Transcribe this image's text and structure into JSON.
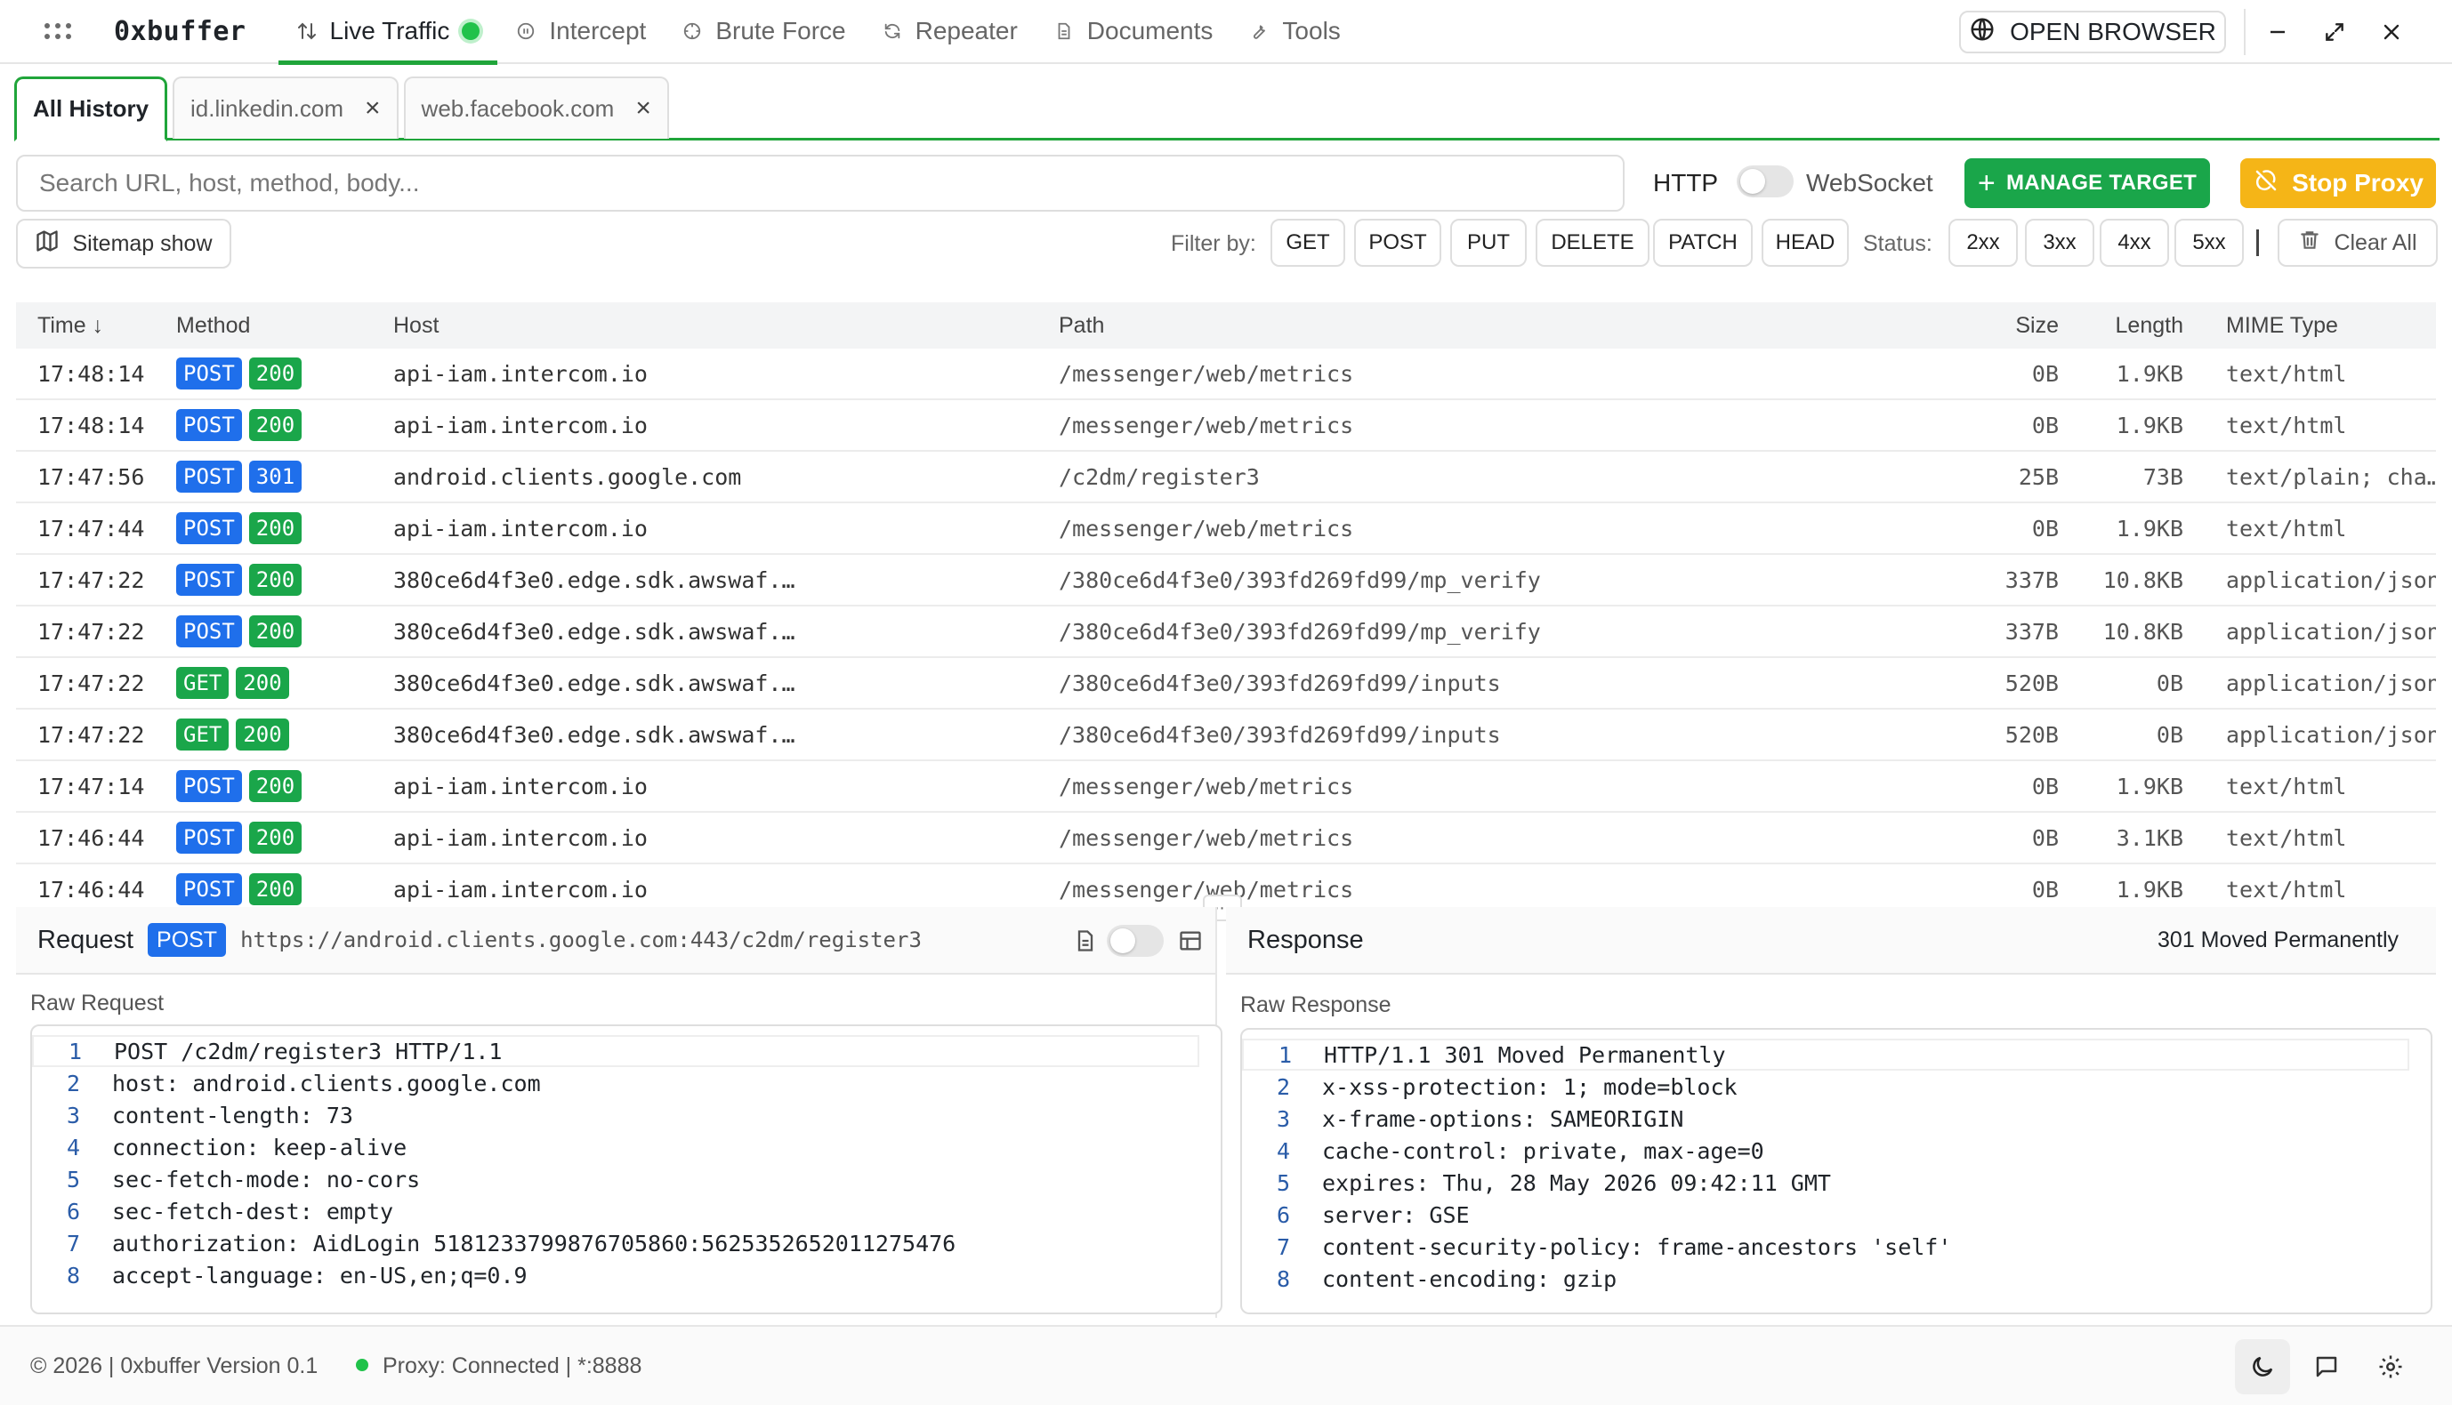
{
  "app": {
    "brand": "0xbuffer",
    "nav_tabs": [
      {
        "label": "Live Traffic",
        "icon": "arrows-up-down-icon",
        "active": true
      },
      {
        "label": "Intercept",
        "icon": "pause-circle-icon"
      },
      {
        "label": "Brute Force",
        "icon": "crosshair-icon"
      },
      {
        "label": "Repeater",
        "icon": "refresh-icon"
      },
      {
        "label": "Documents",
        "icon": "document-icon"
      },
      {
        "label": "Tools",
        "icon": "wrench-icon"
      }
    ],
    "open_browser_label": "OPEN BROWSER"
  },
  "history_tabs": [
    {
      "label": "All History",
      "active": true
    },
    {
      "label": "id.linkedin.com",
      "closable": true
    },
    {
      "label": "web.facebook.com",
      "closable": true
    }
  ],
  "search": {
    "placeholder": "Search URL, host, method, body..."
  },
  "protocol": {
    "left": "HTTP",
    "right": "WebSocket"
  },
  "actions": {
    "manage_target": "MANAGE TARGET",
    "stop_proxy": "Stop Proxy",
    "sitemap": "Sitemap show",
    "clear_all": "Clear All"
  },
  "filters": {
    "filter_label": "Filter by:",
    "methods": [
      "GET",
      "POST",
      "PUT",
      "DELETE",
      "PATCH",
      "HEAD"
    ],
    "status_label": "Status:",
    "statuses": [
      "2xx",
      "3xx",
      "4xx",
      "5xx"
    ]
  },
  "table": {
    "columns": {
      "time": "Time ↓",
      "method": "Method",
      "host": "Host",
      "path": "Path",
      "size": "Size",
      "length": "Length",
      "mime": "MIME Type"
    },
    "rows": [
      {
        "time": "17:48:14",
        "method": "POST",
        "status": "200",
        "host": "api-iam.intercom.io",
        "path": "/messenger/web/metrics",
        "size": "0B",
        "length": "1.9KB",
        "mime": "text/html"
      },
      {
        "time": "17:48:14",
        "method": "POST",
        "status": "200",
        "host": "api-iam.intercom.io",
        "path": "/messenger/web/metrics",
        "size": "0B",
        "length": "1.9KB",
        "mime": "text/html"
      },
      {
        "time": "17:47:56",
        "method": "POST",
        "status": "301",
        "host": "android.clients.google.com",
        "path": "/c2dm/register3",
        "size": "25B",
        "length": "73B",
        "mime": "text/plain; cha…"
      },
      {
        "time": "17:47:44",
        "method": "POST",
        "status": "200",
        "host": "api-iam.intercom.io",
        "path": "/messenger/web/metrics",
        "size": "0B",
        "length": "1.9KB",
        "mime": "text/html"
      },
      {
        "time": "17:47:22",
        "method": "POST",
        "status": "200",
        "host": "380ce6d4f3e0.edge.sdk.awswaf.…",
        "path": "/380ce6d4f3e0/393fd269fd99/mp_verify",
        "size": "337B",
        "length": "10.8KB",
        "mime": "application/json"
      },
      {
        "time": "17:47:22",
        "method": "POST",
        "status": "200",
        "host": "380ce6d4f3e0.edge.sdk.awswaf.…",
        "path": "/380ce6d4f3e0/393fd269fd99/mp_verify",
        "size": "337B",
        "length": "10.8KB",
        "mime": "application/json"
      },
      {
        "time": "17:47:22",
        "method": "GET",
        "status": "200",
        "host": "380ce6d4f3e0.edge.sdk.awswaf.…",
        "path": "/380ce6d4f3e0/393fd269fd99/inputs",
        "size": "520B",
        "length": "0B",
        "mime": "application/json"
      },
      {
        "time": "17:47:22",
        "method": "GET",
        "status": "200",
        "host": "380ce6d4f3e0.edge.sdk.awswaf.…",
        "path": "/380ce6d4f3e0/393fd269fd99/inputs",
        "size": "520B",
        "length": "0B",
        "mime": "application/json"
      },
      {
        "time": "17:47:14",
        "method": "POST",
        "status": "200",
        "host": "api-iam.intercom.io",
        "path": "/messenger/web/metrics",
        "size": "0B",
        "length": "1.9KB",
        "mime": "text/html"
      },
      {
        "time": "17:46:44",
        "method": "POST",
        "status": "200",
        "host": "api-iam.intercom.io",
        "path": "/messenger/web/metrics",
        "size": "0B",
        "length": "3.1KB",
        "mime": "text/html"
      },
      {
        "time": "17:46:44",
        "method": "POST",
        "status": "200",
        "host": "api-iam.intercom.io",
        "path": "/messenger/web/metrics",
        "size": "0B",
        "length": "1.9KB",
        "mime": "text/html"
      }
    ]
  },
  "request": {
    "title": "Request",
    "method": "POST",
    "url": "https://android.clients.google.com:443/c2dm/register3",
    "section_label": "Raw Request",
    "lines": [
      "POST /c2dm/register3 HTTP/1.1",
      "host: android.clients.google.com",
      "content-length: 73",
      "connection: keep-alive",
      "sec-fetch-mode: no-cors",
      "sec-fetch-dest: empty",
      "authorization: AidLogin 5181233799876705860:5625352652011275476",
      "accept-language: en-US,en;q=0.9"
    ]
  },
  "response": {
    "title": "Response",
    "status": "301 Moved Permanently",
    "section_label": "Raw Response",
    "lines": [
      "HTTP/1.1 301 Moved Permanently",
      "x-xss-protection: 1; mode=block",
      "x-frame-options: SAMEORIGIN",
      "cache-control: private, max-age=0",
      "expires: Thu, 28 May 2026 09:42:11 GMT",
      "server: GSE",
      "content-security-policy: frame-ancestors 'self'",
      "content-encoding: gzip"
    ]
  },
  "footer": {
    "copyright": "© 2026 | 0xbuffer Version 0.1",
    "proxy_status": "Proxy: Connected | *:8888"
  },
  "colors": {
    "accent_green": "#1aa64a",
    "post_blue": "#1f6feb",
    "stop_amber": "#f5b517"
  }
}
